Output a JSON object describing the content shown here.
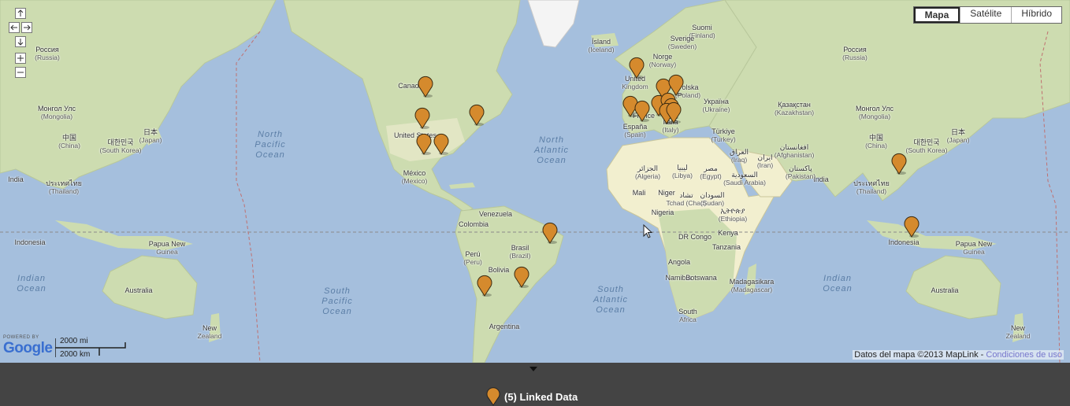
{
  "map": {
    "map_type_buttons": [
      "Mapa",
      "Satélite",
      "Híbrido"
    ],
    "selected_type": "Mapa",
    "nav_controls": [
      "pan-up",
      "pan-left",
      "pan-right",
      "pan-down",
      "zoom-in",
      "zoom-out"
    ],
    "logo": {
      "powered_by": "POWERED BY",
      "brand": "Google"
    },
    "scale": {
      "mi": "2000 mi",
      "km": "2000 km"
    },
    "attribution": {
      "text": "Datos del mapa ©2013 MapLink - ",
      "link": "Condiciones de uso"
    },
    "ocean_labels": [
      {
        "t": "North\nPacific\nOcean"
      },
      {
        "t": "North\nAtlantic\nOcean"
      },
      {
        "t": "South\nPacific\nOcean"
      },
      {
        "t": "South\nAtlantic\nOcean"
      },
      {
        "t": "Indian\nOcean"
      },
      {
        "t": "Indian\nOcean"
      }
    ],
    "place_labels": [
      {
        "t": "Россия",
        "s": "(Russia)"
      },
      {
        "t": "Россия",
        "s": "(Russia)"
      },
      {
        "t": "Монгол Улс",
        "s": "(Mongolia)"
      },
      {
        "t": "Монгол Улс",
        "s": "(Mongolia)"
      },
      {
        "t": "中国",
        "s": "(China)"
      },
      {
        "t": "中国",
        "s": "(China)"
      },
      {
        "t": "日本",
        "s": "(Japan)"
      },
      {
        "t": "日本",
        "s": "(Japan)"
      },
      {
        "t": "대한민국",
        "s": "(South Korea)"
      },
      {
        "t": "대한민국",
        "s": "(South Korea)"
      },
      {
        "t": "India",
        "s": ""
      },
      {
        "t": "India",
        "s": ""
      },
      {
        "t": "ประเทศไทย",
        "s": "(Thailand)"
      },
      {
        "t": "ประเทศไทย",
        "s": "(Thailand)"
      },
      {
        "t": "Indonesia",
        "s": ""
      },
      {
        "t": "Indonesia",
        "s": ""
      },
      {
        "t": "Papua New",
        "s": "Guinea"
      },
      {
        "t": "Papua New",
        "s": "Guinea"
      },
      {
        "t": "Australia",
        "s": ""
      },
      {
        "t": "Australia",
        "s": ""
      },
      {
        "t": "New",
        "s": "Zealand"
      },
      {
        "t": "New",
        "s": "Zealand"
      },
      {
        "t": "Canada",
        "s": ""
      },
      {
        "t": "United States",
        "s": ""
      },
      {
        "t": "México",
        "s": "(Mexico)"
      },
      {
        "t": "Venezuela",
        "s": ""
      },
      {
        "t": "Colombia",
        "s": ""
      },
      {
        "t": "Perú",
        "s": "(Peru)"
      },
      {
        "t": "Brasil",
        "s": "(Brazil)"
      },
      {
        "t": "Bolivia",
        "s": ""
      },
      {
        "t": "Argentina",
        "s": ""
      },
      {
        "t": "Ísland",
        "s": "(Iceland)"
      },
      {
        "t": "Suomi",
        "s": "(Finland)"
      },
      {
        "t": "Sverige",
        "s": "(Sweden)"
      },
      {
        "t": "Norge",
        "s": "(Norway)"
      },
      {
        "t": "United",
        "s": "Kingdom"
      },
      {
        "t": "Polska",
        "s": "(Poland)"
      },
      {
        "t": "Україна",
        "s": "(Ukraine)"
      },
      {
        "t": "España",
        "s": "(Spain)"
      },
      {
        "t": "France",
        "s": ""
      },
      {
        "t": "Italia",
        "s": "(Italy)"
      },
      {
        "t": "Türkiye",
        "s": "(Turkey)"
      },
      {
        "t": "Қазақстан",
        "s": "(Kazakhstan)"
      },
      {
        "t": "الجزائر",
        "s": "(Algeria)"
      },
      {
        "t": "ليبيا",
        "s": "(Libya)"
      },
      {
        "t": "مصر",
        "s": "(Egypt)"
      },
      {
        "t": "العراق",
        "s": "(Iraq)"
      },
      {
        "t": "ایران",
        "s": "(Iran)"
      },
      {
        "t": "افغانستان",
        "s": "(Afghanistan)"
      },
      {
        "t": "پاکستان",
        "s": "(Pakistan)"
      },
      {
        "t": "السعودية",
        "s": "(Saudi Arabia)"
      },
      {
        "t": "Mali",
        "s": ""
      },
      {
        "t": "Niger",
        "s": ""
      },
      {
        "t": "تشاد",
        "s": "Tchad (Chad)"
      },
      {
        "t": "السودان",
        "s": "(Sudan)"
      },
      {
        "t": "Nigeria",
        "s": ""
      },
      {
        "t": "ኢትዮጵያ",
        "s": "(Ethiopia)"
      },
      {
        "t": "DR Congo",
        "s": ""
      },
      {
        "t": "Kenya",
        "s": ""
      },
      {
        "t": "Tanzania",
        "s": ""
      },
      {
        "t": "Angola",
        "s": ""
      },
      {
        "t": "Namibia",
        "s": ""
      },
      {
        "t": "Botswana",
        "s": ""
      },
      {
        "t": "Madagasikara",
        "s": "(Madagascar)"
      },
      {
        "t": "South",
        "s": "Africa"
      }
    ],
    "marker_color": "#d58a2d"
  },
  "legend": {
    "label": "(5) Linked Data",
    "marker_color": "#d58a2d"
  }
}
